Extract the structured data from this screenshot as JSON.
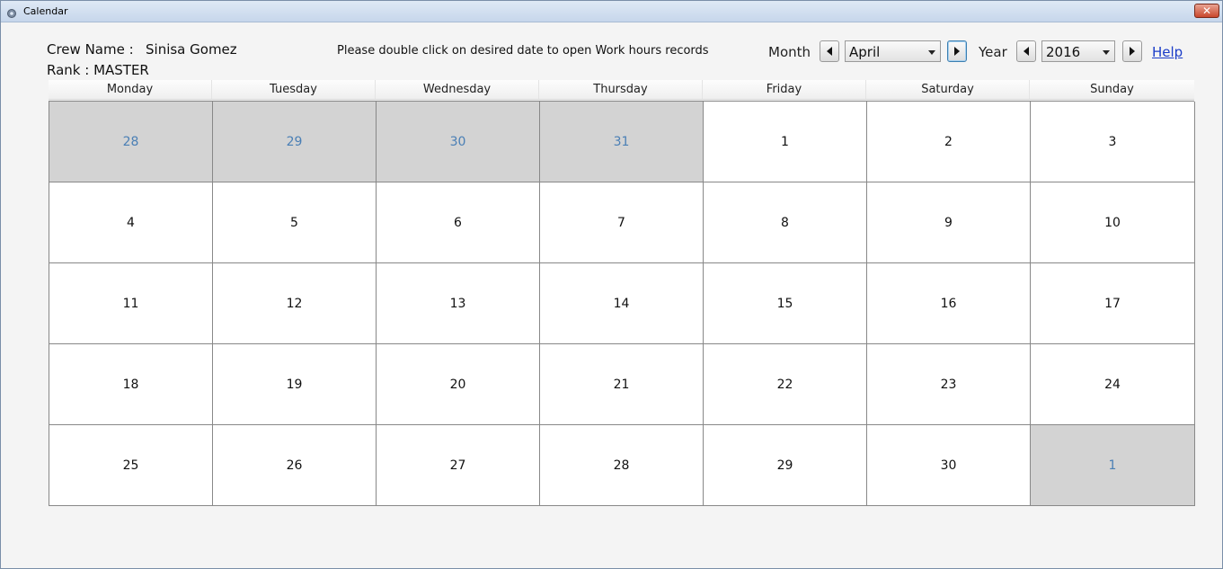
{
  "window": {
    "title": "Calendar",
    "close_label": "✕"
  },
  "crew": {
    "name_label": "Crew Name :",
    "name_value": "Sinisa Gomez",
    "rank_text": "Rank : MASTER"
  },
  "instruction": "Please double click on desired date to open Work hours records",
  "controls": {
    "month_label": "Month",
    "month_value": "April",
    "year_label": "Year",
    "year_value": "2016",
    "help_label": "Help"
  },
  "weekdays": [
    "Monday",
    "Tuesday",
    "Wednesday",
    "Thursday",
    "Friday",
    "Saturday",
    "Sunday"
  ],
  "days": [
    {
      "d": "28",
      "other": true
    },
    {
      "d": "29",
      "other": true
    },
    {
      "d": "30",
      "other": true
    },
    {
      "d": "31",
      "other": true
    },
    {
      "d": "1",
      "other": false
    },
    {
      "d": "2",
      "other": false
    },
    {
      "d": "3",
      "other": false
    },
    {
      "d": "4",
      "other": false
    },
    {
      "d": "5",
      "other": false
    },
    {
      "d": "6",
      "other": false
    },
    {
      "d": "7",
      "other": false
    },
    {
      "d": "8",
      "other": false
    },
    {
      "d": "9",
      "other": false
    },
    {
      "d": "10",
      "other": false
    },
    {
      "d": "11",
      "other": false
    },
    {
      "d": "12",
      "other": false
    },
    {
      "d": "13",
      "other": false
    },
    {
      "d": "14",
      "other": false
    },
    {
      "d": "15",
      "other": false
    },
    {
      "d": "16",
      "other": false
    },
    {
      "d": "17",
      "other": false
    },
    {
      "d": "18",
      "other": false
    },
    {
      "d": "19",
      "other": false
    },
    {
      "d": "20",
      "other": false
    },
    {
      "d": "21",
      "other": false
    },
    {
      "d": "22",
      "other": false
    },
    {
      "d": "23",
      "other": false
    },
    {
      "d": "24",
      "other": false
    },
    {
      "d": "25",
      "other": false
    },
    {
      "d": "26",
      "other": false
    },
    {
      "d": "27",
      "other": false
    },
    {
      "d": "28",
      "other": false
    },
    {
      "d": "29",
      "other": false
    },
    {
      "d": "30",
      "other": false
    },
    {
      "d": "1",
      "other": true
    }
  ],
  "colors": {
    "other_month_bg": "#d3d3d3",
    "other_month_text": "#4a7fb5",
    "link": "#1a3cc8"
  }
}
